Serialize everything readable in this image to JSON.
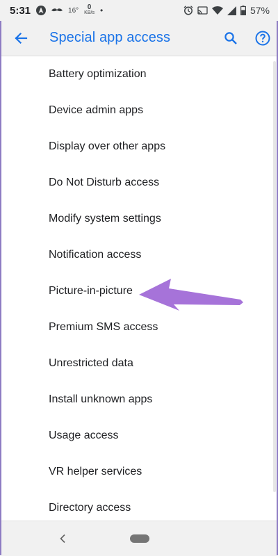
{
  "status_bar": {
    "time": "5:31",
    "temperature": "16°",
    "network_speed": "0",
    "network_unit": "KB/s",
    "battery": "57%",
    "icons": [
      "navigation-icon",
      "mustache-icon",
      "dot-icon",
      "alarm-icon",
      "cast-icon",
      "wifi-icon",
      "signal-icon",
      "battery-icon"
    ]
  },
  "app_bar": {
    "title": "Special app access",
    "back_icon": "arrow-back-icon",
    "search_icon": "search-icon",
    "help_icon": "help-icon",
    "accent_color": "#1a73e8"
  },
  "items": [
    {
      "label": "Battery optimization"
    },
    {
      "label": "Device admin apps"
    },
    {
      "label": "Display over other apps"
    },
    {
      "label": "Do Not Disturb access"
    },
    {
      "label": "Modify system settings"
    },
    {
      "label": "Notification access"
    },
    {
      "label": "Picture-in-picture"
    },
    {
      "label": "Premium SMS access"
    },
    {
      "label": "Unrestricted data"
    },
    {
      "label": "Install unknown apps"
    },
    {
      "label": "Usage access"
    },
    {
      "label": "VR helper services"
    },
    {
      "label": "Directory access"
    }
  ],
  "annotation": {
    "type": "arrow",
    "points_to": "Picture-in-picture",
    "color": "#a673d9"
  },
  "nav_bar": {
    "back_icon": "chevron-left-icon",
    "home_icon": "home-pill-icon"
  }
}
